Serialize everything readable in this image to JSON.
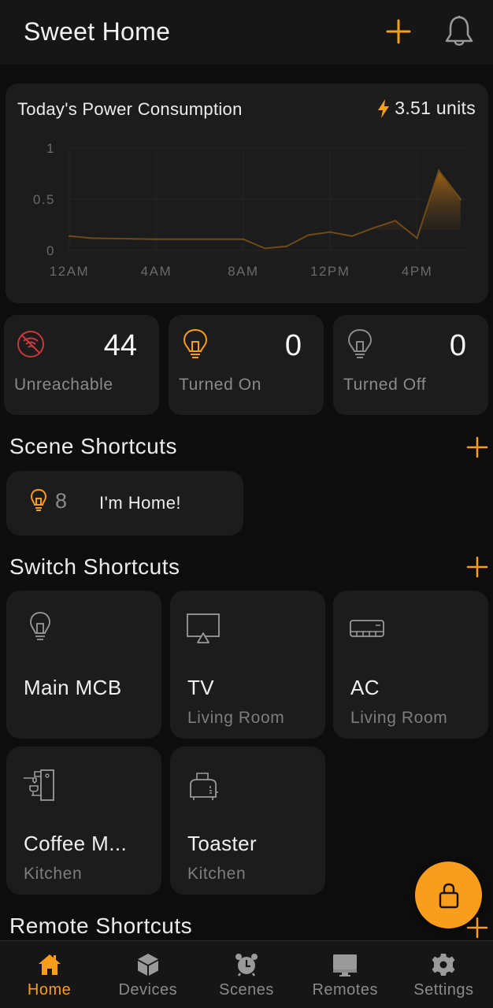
{
  "header": {
    "title": "Sweet Home",
    "add_icon": "plus-icon",
    "notifications_icon": "bell-icon"
  },
  "colors": {
    "accent": "#f99d1c",
    "background": "#0d0d0d",
    "card": "#1c1c1c",
    "unreachable": "#c8383c",
    "muted": "#8a8a8a"
  },
  "power": {
    "title": "Today's Power Consumption",
    "icon": "lightning-icon",
    "total": "3.51 units"
  },
  "chart_data": {
    "type": "line",
    "title": "Today's Power Consumption",
    "xlabel": "",
    "ylabel": "",
    "x_unit": "hour of day",
    "x": [
      0,
      1,
      4,
      8,
      9,
      10,
      11,
      12,
      13,
      14,
      15,
      16,
      17,
      18
    ],
    "values": [
      0.14,
      0.12,
      0.11,
      0.11,
      0.02,
      0.04,
      0.15,
      0.18,
      0.14,
      0.22,
      0.29,
      0.12,
      0.78,
      0.5
    ],
    "xticks": [
      {
        "value": 0,
        "label": "12AM"
      },
      {
        "value": 4,
        "label": "4AM"
      },
      {
        "value": 8,
        "label": "8AM"
      },
      {
        "value": 12,
        "label": "12PM"
      },
      {
        "value": 16,
        "label": "4PM"
      }
    ],
    "yticks": [
      {
        "value": 0,
        "label": "0"
      },
      {
        "value": 0.5,
        "label": "0.5"
      },
      {
        "value": 1,
        "label": "1"
      }
    ],
    "xlim": [
      0,
      18
    ],
    "ylim": [
      0,
      1
    ],
    "grid": true,
    "legend": "none",
    "fill": "gradient area under line"
  },
  "stats": [
    {
      "value": "44",
      "label": "Unreachable",
      "icon": "wifi-off-icon"
    },
    {
      "value": "0",
      "label": "Turned On",
      "icon": "bulb-on-icon"
    },
    {
      "value": "0",
      "label": "Turned Off",
      "icon": "bulb-off-icon"
    }
  ],
  "scene_shortcuts": {
    "title": "Scene Shortcuts",
    "add_icon": "plus-icon",
    "items": [
      {
        "count": "8",
        "name": "I'm Home!",
        "icon": "bulb-icon"
      }
    ]
  },
  "switch_shortcuts": {
    "title": "Switch Shortcuts",
    "add_icon": "plus-icon",
    "items": [
      {
        "name": "Main MCB",
        "room": "",
        "icon": "bulb-icon"
      },
      {
        "name": "TV",
        "room": "Living Room",
        "icon": "tv-icon"
      },
      {
        "name": "AC",
        "room": "Living Room",
        "icon": "air-conditioner-icon"
      },
      {
        "name": "Coffee M...",
        "room": "Kitchen",
        "icon": "coffee-machine-icon"
      },
      {
        "name": "Toaster",
        "room": "Kitchen",
        "icon": "toaster-icon"
      }
    ]
  },
  "remote_shortcuts": {
    "title": "Remote Shortcuts",
    "add_icon": "plus-icon"
  },
  "fab": {
    "icon": "lock-icon"
  },
  "nav": {
    "active": "Home",
    "items": [
      {
        "label": "Home",
        "icon": "home-icon"
      },
      {
        "label": "Devices",
        "icon": "cube-icon"
      },
      {
        "label": "Scenes",
        "icon": "alarm-clock-icon"
      },
      {
        "label": "Remotes",
        "icon": "monitor-icon"
      },
      {
        "label": "Settings",
        "icon": "gear-icon"
      }
    ]
  }
}
